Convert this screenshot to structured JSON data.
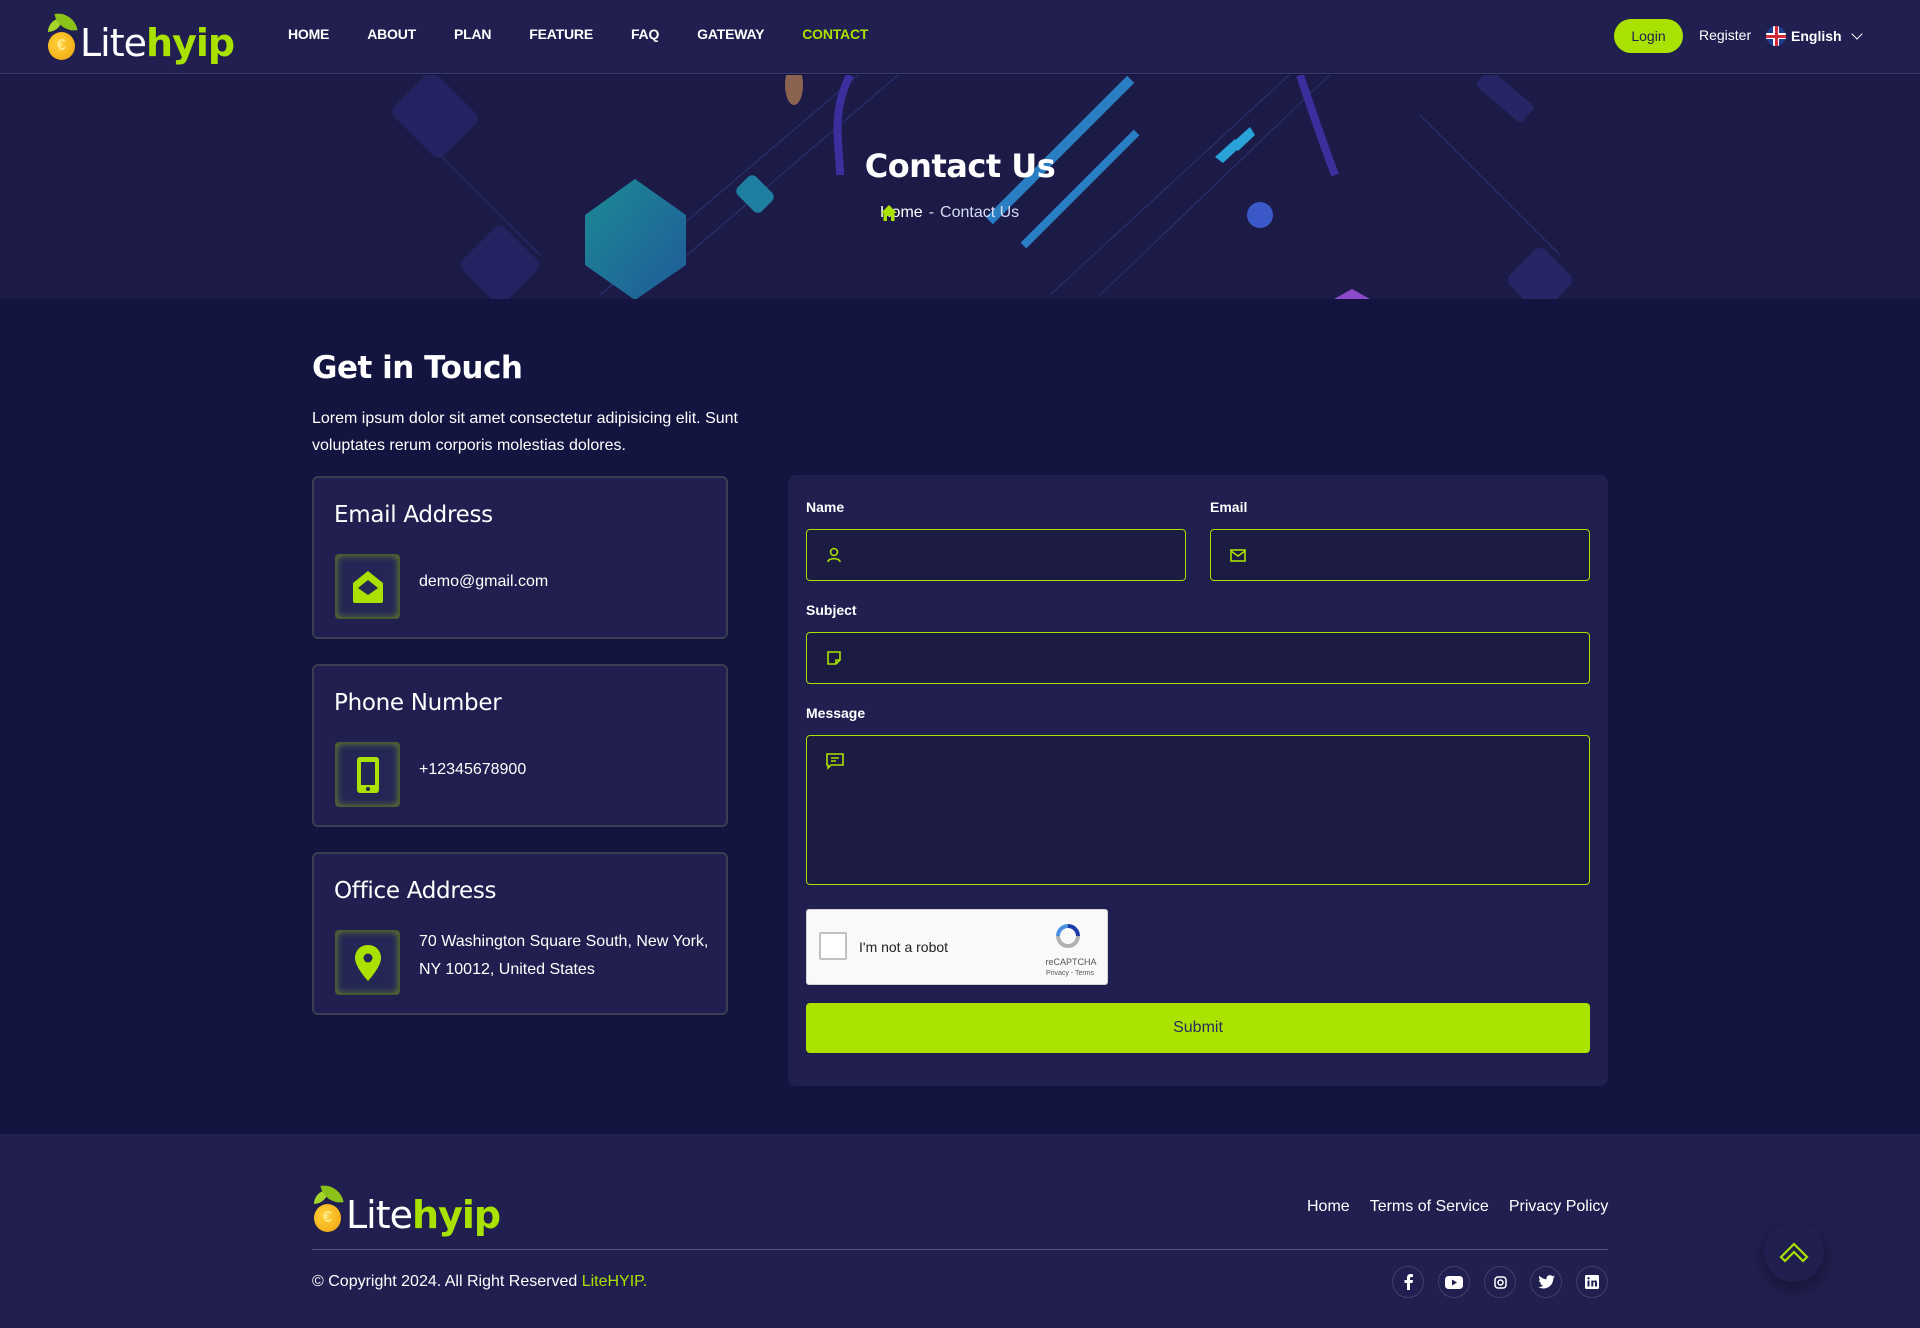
{
  "brand": {
    "logo_part1": "Lite",
    "logo_part2": "hyip",
    "accent_color": "#a9e100",
    "background_color": "#13143f",
    "panel_color": "#201f4f"
  },
  "header": {
    "nav": [
      {
        "label": "HOME",
        "active": false
      },
      {
        "label": "ABOUT",
        "active": false
      },
      {
        "label": "PLAN",
        "active": false
      },
      {
        "label": "FEATURE",
        "active": false
      },
      {
        "label": "FAQ",
        "active": false
      },
      {
        "label": "GATEWAY",
        "active": false
      },
      {
        "label": "CONTACT",
        "active": true
      }
    ],
    "login_label": "Login",
    "register_label": "Register",
    "language": "English"
  },
  "banner": {
    "title": "Contact Us",
    "breadcrumb_home": "Home",
    "breadcrumb_separator": "-",
    "breadcrumb_current": "Contact Us"
  },
  "intro": {
    "title": "Get in Touch",
    "description": "Lorem ipsum dolor sit amet consectetur adipisicing elit. Sunt voluptates rerum corporis molestias dolores."
  },
  "info_cards": [
    {
      "title": "Email Address",
      "icon": "envelope-open-icon",
      "value": "demo@gmail.com"
    },
    {
      "title": "Phone Number",
      "icon": "mobile-phone-icon",
      "value": "+12345678900"
    },
    {
      "title": "Office Address",
      "icon": "map-marker-icon",
      "value": "70 Washington Square South, New York, NY 10012, United States"
    }
  ],
  "form": {
    "name_label": "Name",
    "name_value": "",
    "email_label": "Email",
    "email_value": "",
    "subject_label": "Subject",
    "subject_value": "",
    "message_label": "Message",
    "message_value": "",
    "captcha_label": "I'm not a robot",
    "captcha_brand": "reCAPTCHA",
    "captcha_terms": "Privacy - Terms",
    "submit_label": "Submit"
  },
  "footer": {
    "links": [
      "Home",
      "Terms of Service",
      "Privacy Policy"
    ],
    "copyright_prefix": "© Copyright 2024. All Right Reserved ",
    "copyright_brand": "LiteHYIP.",
    "socials": [
      "facebook",
      "youtube",
      "instagram",
      "twitter",
      "linkedin"
    ]
  }
}
